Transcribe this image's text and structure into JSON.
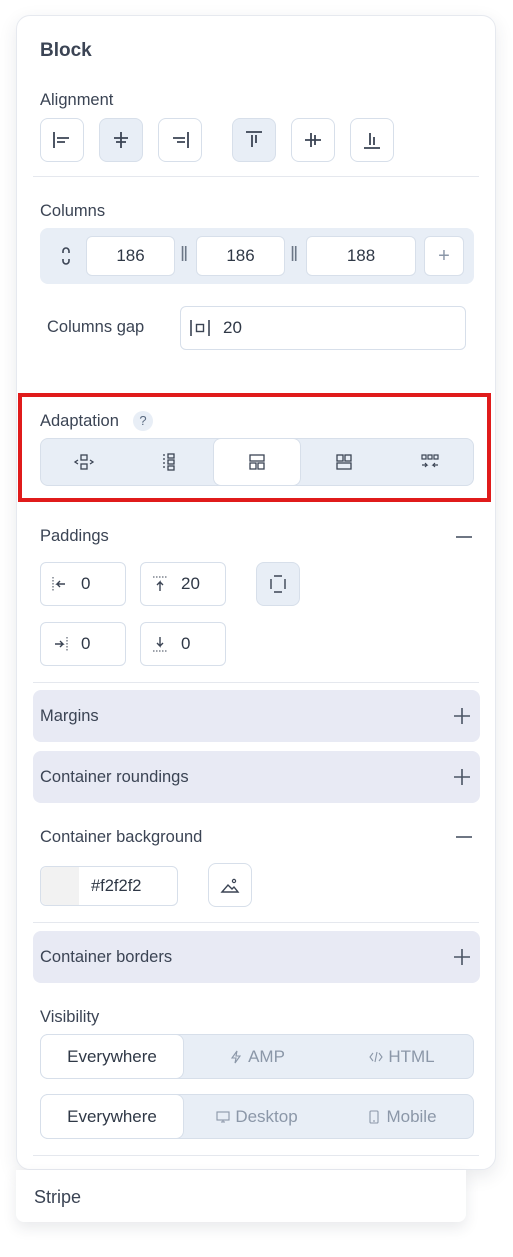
{
  "block": {
    "title": "Block",
    "alignment_label": "Alignment",
    "columns_label": "Columns",
    "columns": [
      "186",
      "186",
      "188"
    ],
    "add_column": "+",
    "columns_gap_label": "Columns gap",
    "columns_gap_value": "20",
    "adaptation_label": "Adaptation",
    "adaptation_help": "?",
    "paddings_label": "Paddings",
    "paddings": {
      "left": "0",
      "top": "20",
      "right": "0",
      "bottom": "0"
    },
    "margins_label": "Margins",
    "roundings_label": "Container roundings",
    "background_label": "Container background",
    "background_color": "#f2f2f2",
    "borders_label": "Container borders",
    "visibility_label": "Visibility",
    "visibility_format": [
      "Everywhere",
      "AMP",
      "HTML"
    ],
    "visibility_device": [
      "Everywhere",
      "Desktop",
      "Mobile"
    ]
  },
  "stripe": {
    "label": "Stripe"
  },
  "colors": {
    "highlight": "#e01b1b",
    "accent_bg": "#e8eef6",
    "border": "#d7dfea"
  }
}
